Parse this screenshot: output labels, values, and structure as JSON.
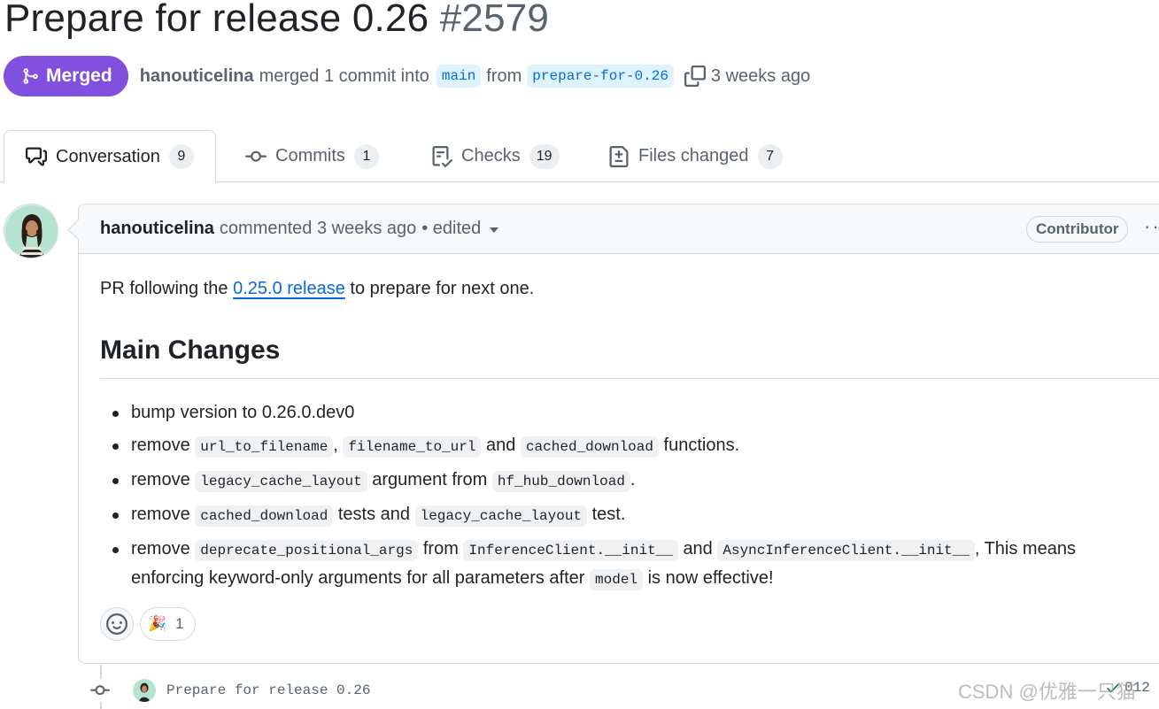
{
  "pr": {
    "title": "Prepare for release 0.26",
    "number": "#2579",
    "state": "Merged",
    "author": "hanouticelina",
    "action_text": "merged 1 commit into",
    "base_branch": "main",
    "from_text": "from",
    "head_branch": "prepare-for-0.26",
    "time_ago": "3 weeks ago"
  },
  "tabs": [
    {
      "label": "Conversation",
      "count": "9",
      "icon": "comment-discussion-icon"
    },
    {
      "label": "Commits",
      "count": "1",
      "icon": "git-commit-icon"
    },
    {
      "label": "Checks",
      "count": "19",
      "icon": "checklist-icon"
    },
    {
      "label": "Files changed",
      "count": "7",
      "icon": "file-diff-icon"
    }
  ],
  "comment": {
    "author": "hanouticelina",
    "meta": "commented 3 weeks ago",
    "edited": "• edited",
    "role": "Contributor",
    "more": "···",
    "intro_before": "PR following the",
    "intro_link": "0.25.0 release",
    "intro_after": "to prepare for next one.",
    "heading": "Main Changes",
    "items": {
      "i1": {
        "text": "bump version to 0.26.0.dev0"
      },
      "i2": {
        "t1": "remove",
        "c1": "url_to_filename",
        "t2": ",",
        "c2": "filename_to_url",
        "t3": "and",
        "c3": "cached_download",
        "t4": "functions."
      },
      "i3": {
        "t1": "remove",
        "c1": "legacy_cache_layout",
        "t2": "argument from",
        "c2": "hf_hub_download",
        "t3": "."
      },
      "i4": {
        "t1": "remove",
        "c1": "cached_download",
        "t2": "tests and",
        "c2": "legacy_cache_layout",
        "t3": "test."
      },
      "i5": {
        "t1": "remove",
        "c1": "deprecate_positional_args",
        "t2": "from",
        "c2": "InferenceClient.__init__",
        "t3": "and",
        "c3": "AsyncInferenceClient.__init__",
        "t4": ", This means enforcing keyword-only arguments for all parameters after",
        "c4": "model",
        "t5": "is now effective!"
      }
    },
    "reactions": {
      "emoji": "🎉",
      "count": "1"
    }
  },
  "timeline": {
    "commit_message": "Prepare for release 0.26",
    "commit_sha": "012"
  },
  "watermark": "CSDN @优雅一只猫",
  "colors": {
    "merged": "#8250df",
    "link": "#0969da",
    "branch_bg": "#ddf4ff",
    "border": "#d1d9e0",
    "muted": "#59636e"
  }
}
